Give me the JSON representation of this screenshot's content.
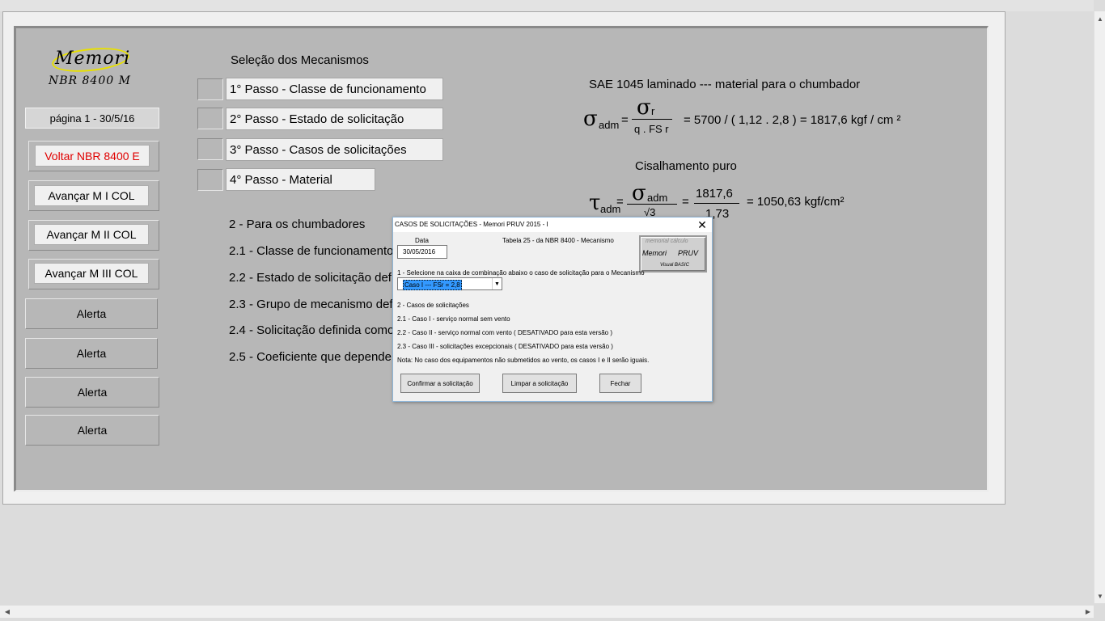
{
  "logo": {
    "title": "Memori",
    "subtitle": "NBR 8400 M"
  },
  "sidebar": {
    "page_label": "página 1 -   30/5/16",
    "buttons": [
      {
        "label": "Voltar NBR 8400 E",
        "color": "#e00000"
      },
      {
        "label": "Avançar M I COL"
      },
      {
        "label": "Avançar M II COL"
      },
      {
        "label": "Avançar M III COL"
      }
    ],
    "alerts": [
      "Alerta",
      "Alerta",
      "Alerta",
      "Alerta"
    ]
  },
  "selection": {
    "title": "Seleção dos Mecanismos",
    "steps": [
      "1° Passo - Classe de funcionamento",
      "2° Passo - Estado de solicitação",
      "3° Passo - Casos de solicitações",
      "4° Passo - Material"
    ]
  },
  "section": {
    "lines": [
      "2 - Para os chumbadores",
      "2.1 - Classe de funcionamento",
      "2.2 - Estado de solicitação definido",
      "2.3 - Grupo de mecanismo definido",
      "2.4 - Solicitação definida como",
      "2.5 - Coeficiente que depende"
    ]
  },
  "formulas": {
    "material": "SAE 1045 laminado --- material para o chumbador",
    "sigma_symbol": "σ",
    "sigma_sub": "adm",
    "equals": "=",
    "num_symbol": "σ",
    "num_sub": "r",
    "denominator": "q . FS r",
    "sigma_result": "= 5700 / ( 1,12 . 2,8 ) = 1817,6  kgf / cm ²",
    "shear_title": "Cisalhamento puro",
    "tau_symbol": "τ",
    "tau_sub": "adm",
    "tau_equals": "=",
    "tau_num_symbol": "σ",
    "tau_num_sub": "adm",
    "tau_den": "√3",
    "eq2": "=",
    "frac2_num": "1817,6",
    "frac2_den": "1,73",
    "tau_result": "= 1050,63 kgf/cm²"
  },
  "dialog": {
    "title": "CASOS DE SOLICITAÇÕES - Memori PRUV 2015 - I",
    "close": "✕",
    "date_label": "Data",
    "date_value": "30/05/2016",
    "table_ref": "Tabela 25 -  da  NBR 8400 - Mecanismo",
    "instruction": "1 - Selecione na caixa de combinação abaixo o caso de solicitação para o Mecanismo",
    "combo_value": "Caso I   --- FSr = 2,8",
    "cases_title": "2 - Casos de solicitações",
    "case1": "2.1 - Caso I   - serviço normal sem vento",
    "case2": "2.2 - Caso II   - serviço normal com vento  ( DESATIVADO para esta versão )",
    "case3": "2.3 - Caso III   - solicitações excepcionais  ( DESATIVADO para esta versão )",
    "note": "Nota: No caso dos equipamentos não submetidos ao vento, os casos I e II serão iguais.",
    "confirm": "Confirmar a solicitação",
    "clear": "Limpar a solicitação",
    "close_btn": "Fechar",
    "logo_top": "memorial  cálculo",
    "logo_mid_left": "Memori",
    "logo_mid_right": "PRUV",
    "logo_bottom": "Visual BASIC"
  }
}
